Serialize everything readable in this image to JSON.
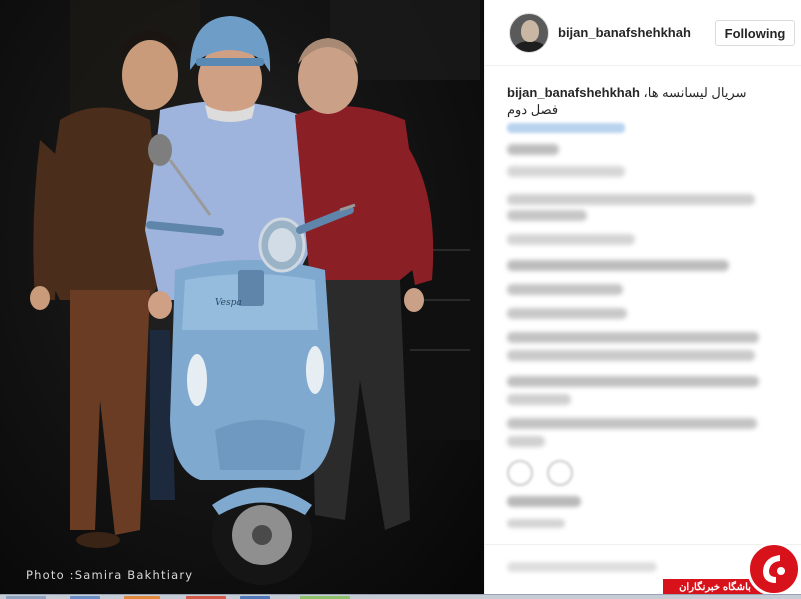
{
  "post": {
    "username": "bijan_banafshehkhah",
    "follow_button": "Following",
    "caption_user": "bijan_banafshehkhah",
    "caption_text": "سریال لیسانسه ها، فصل دوم"
  },
  "photo": {
    "credit": "Photo :Samira Bakhtiary",
    "scooter_badge": "Vespa"
  },
  "watermark": {
    "label": "باشگاه خبرنگاران"
  },
  "colors": {
    "accent_red": "#d8121b",
    "scooter_blue": "#7fa9cf",
    "text_primary": "#262626",
    "border": "#dbdbdb"
  },
  "icons": {
    "like": "heart-icon",
    "comment": "speech-bubble-icon"
  }
}
